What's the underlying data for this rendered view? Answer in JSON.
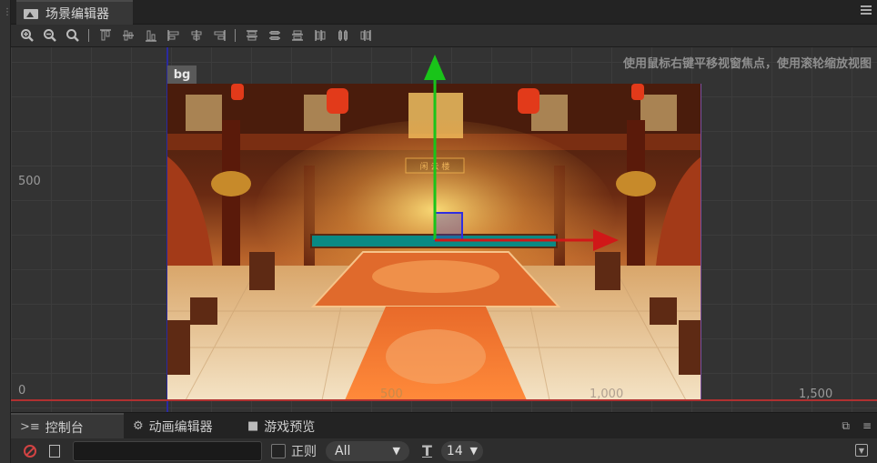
{
  "scene_tab": {
    "label": "场景编辑器"
  },
  "scene": {
    "hint": "使用鼠标右键平移视窗焦点，使用滚轮缩放视图",
    "node_tag": "bg",
    "y_labels": [
      "500",
      "0"
    ],
    "x_labels": [
      "500",
      "1,000",
      "1,500"
    ]
  },
  "bottom_tabs": [
    {
      "label": "控制台",
      "icon": "console-icon"
    },
    {
      "label": "动画编辑器",
      "icon": "animation-icon"
    },
    {
      "label": "游戏预览",
      "icon": "video-camera-icon"
    }
  ],
  "console": {
    "search_value": "",
    "regex_label": "正则",
    "level_filter": "All",
    "font_size": "14"
  },
  "colors": {
    "x_axis": "#b03030",
    "y_axis": "#2a2aa0",
    "gizmo_green": "#19c419",
    "gizmo_red": "#d01818",
    "clear_red": "#d24343"
  }
}
